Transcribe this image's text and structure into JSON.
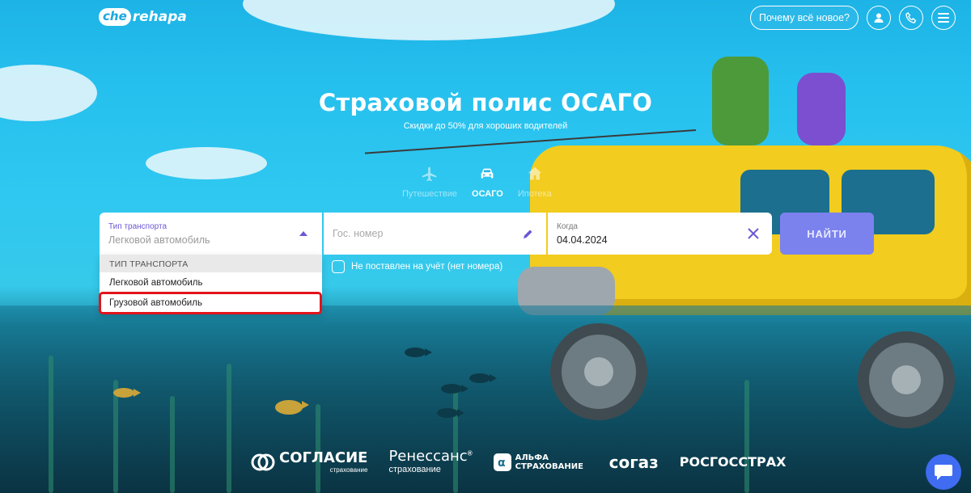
{
  "header": {
    "logo_mark": "che",
    "logo_text": "rehapa",
    "whats_new_label": "Почему всё новое?"
  },
  "hero": {
    "title": "Страховой полис ОСАГО",
    "subtitle": "Скидки до 50% для хороших водителей"
  },
  "tabs": [
    {
      "label": "Путешествие",
      "icon": "airplane-icon",
      "active": false
    },
    {
      "label": "ОСАГО",
      "icon": "car-icon",
      "active": true
    },
    {
      "label": "Ипотека",
      "icon": "house-icon",
      "active": false
    }
  ],
  "form": {
    "vehicle_type": {
      "label": "Тип транспорта",
      "value": "Легковой автомобиль"
    },
    "plate_number": {
      "placeholder": "Гос. номер"
    },
    "date": {
      "label": "Когда",
      "value": "04.04.2024"
    },
    "search_label": "НАЙТИ",
    "no_plate_checkbox_label": "Не поставлен на учёт (нет номера)"
  },
  "dropdown": {
    "header": "ТИП ТРАНСПОРТА",
    "options": [
      "Легковой автомобиль",
      "Грузовой автомобиль"
    ],
    "highlighted_index": 1
  },
  "partners": [
    {
      "name": "СОГЛАСИЕ",
      "sub": "страхование"
    },
    {
      "name": "Ренессанс",
      "sub": "страхование",
      "mark": "®"
    },
    {
      "name": "АЛЬФА СТРАХОВАНИЕ",
      "sub": ""
    },
    {
      "name": "согаз",
      "sub": ""
    },
    {
      "name": "РОСГОССТРАХ",
      "sub": ""
    }
  ],
  "colors": {
    "accent": "#6a57d6",
    "search_button": "#7b82ee",
    "highlight_outline": "#e3131b",
    "chat_button": "#3f6cf0"
  }
}
